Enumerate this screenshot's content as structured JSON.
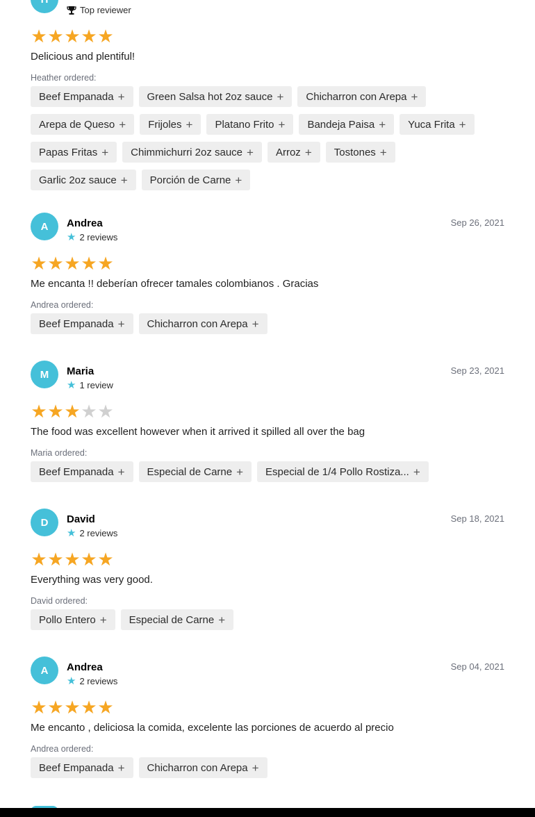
{
  "reviews": [
    {
      "initial": "H",
      "name": "",
      "meta": "Top reviewer",
      "meta_icon": "trophy-icon",
      "date": "",
      "rating": 5,
      "text": "Delicious and plentiful!",
      "ordered_label": "Heather ordered:",
      "items": [
        "Beef Empanada",
        "Green Salsa hot 2oz sauce",
        "Chicharron con Arepa",
        "Arepa de Queso",
        "Frijoles",
        "Platano Frito",
        "Bandeja Paisa",
        "Yuca Frita",
        "Papas Fritas",
        "Chimmichurri 2oz sauce",
        "Arroz",
        "Tostones",
        "Garlic 2oz sauce",
        "Porción de Carne"
      ]
    },
    {
      "initial": "A",
      "name": "Andrea",
      "meta": "2 reviews",
      "meta_icon": "star-icon",
      "date": "Sep 26, 2021",
      "rating": 5,
      "text": "Me encanta !! deberían ofrecer tamales colombianos . Gracias",
      "ordered_label": "Andrea ordered:",
      "items": [
        "Beef Empanada",
        "Chicharron con Arepa"
      ]
    },
    {
      "initial": "M",
      "name": "Maria",
      "meta": "1 review",
      "meta_icon": "star-icon",
      "date": "Sep 23, 2021",
      "rating": 3,
      "text": "The food was excellent however when it arrived it spilled all over the bag",
      "ordered_label": "Maria ordered:",
      "items": [
        "Beef Empanada",
        "Especial de Carne",
        "Especial de 1/4 Pollo Rostiza..."
      ]
    },
    {
      "initial": "D",
      "name": "David",
      "meta": "2 reviews",
      "meta_icon": "star-icon",
      "date": "Sep 18, 2021",
      "rating": 5,
      "text": "Everything was very good.",
      "ordered_label": "David ordered:",
      "items": [
        "Pollo Entero",
        "Especial de Carne"
      ]
    },
    {
      "initial": "A",
      "name": "Andrea",
      "meta": "2 reviews",
      "meta_icon": "star-icon",
      "date": "Sep 04, 2021",
      "rating": 5,
      "text": "Me encanto , deliciosa la comida, excelente las porciones de acuerdo al precio",
      "ordered_label": "Andrea ordered:",
      "items": [
        "Beef Empanada",
        "Chicharron con Arepa"
      ]
    }
  ],
  "colors": {
    "avatar": "#45c0d9",
    "star_on": "#f6a623",
    "star_off": "#d0d0d0",
    "chip_bg": "#eeeeee"
  },
  "icons": {
    "add": "plus-icon",
    "rating": "star-icon"
  }
}
